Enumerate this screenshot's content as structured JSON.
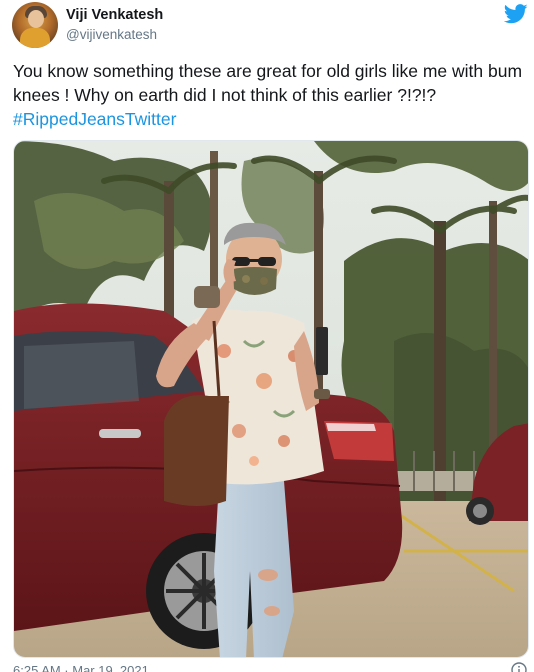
{
  "tweet": {
    "author_name": "Viji Venkatesh",
    "author_handle": "@vijivenkatesh",
    "text_line": "You know something these are great for old girls like me with bum knees ! Why on earth did I not think of this earlier ?!?!?",
    "hashtag": "#RippedJeansTwitter",
    "timestamp": "6:25 AM · Mar 19, 2021",
    "icons": {
      "logo": "twitter-bird-icon",
      "info": "info-icon"
    },
    "colors": {
      "brand": "#1da1f2",
      "hashtag": "#1b95e0",
      "secondary_text": "#657786"
    }
  }
}
